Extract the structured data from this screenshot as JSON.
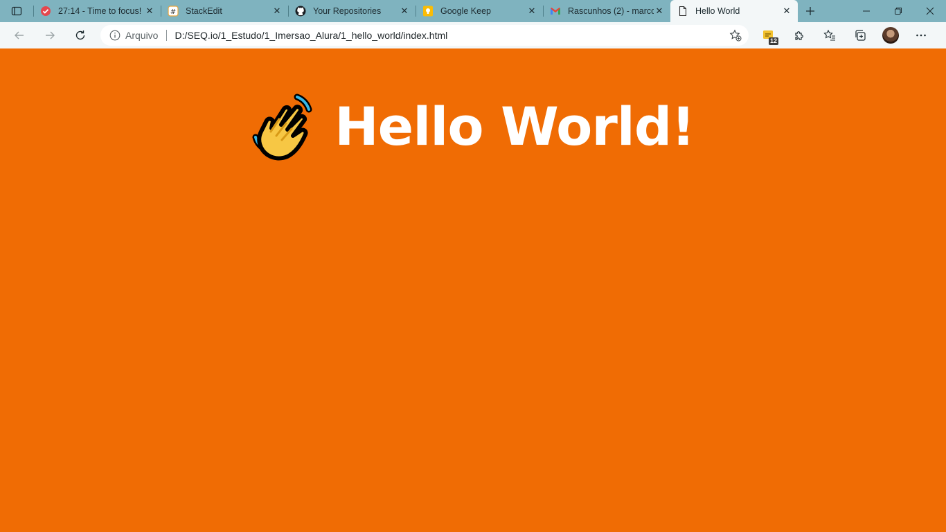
{
  "tabs": [
    {
      "title": "27:14 - Time to focus!",
      "icon": "focus-check-icon",
      "active": false
    },
    {
      "title": "StackEdit",
      "icon": "stackedit-icon",
      "active": false
    },
    {
      "title": "Your Repositories",
      "icon": "github-icon",
      "active": false
    },
    {
      "title": "Google Keep",
      "icon": "keep-icon",
      "active": false
    },
    {
      "title": "Rascunhos (2) - marco",
      "icon": "gmail-icon",
      "active": false
    },
    {
      "title": "Hello World",
      "icon": "page-icon",
      "active": true
    }
  ],
  "address": {
    "scheme_label": "Arquivo",
    "url": "D:/SEQ.io/1_Estudo/1_Imersao_Alura/1_hello_world/index.html"
  },
  "toolbar": {
    "extension_badge": "12"
  },
  "page": {
    "heading": "Hello World!",
    "background_color": "#f06c04",
    "emoji": "waving-hand-icon"
  },
  "colors": {
    "tabstrip": "#7fb3bf",
    "toolbar": "#f3f7f8"
  }
}
